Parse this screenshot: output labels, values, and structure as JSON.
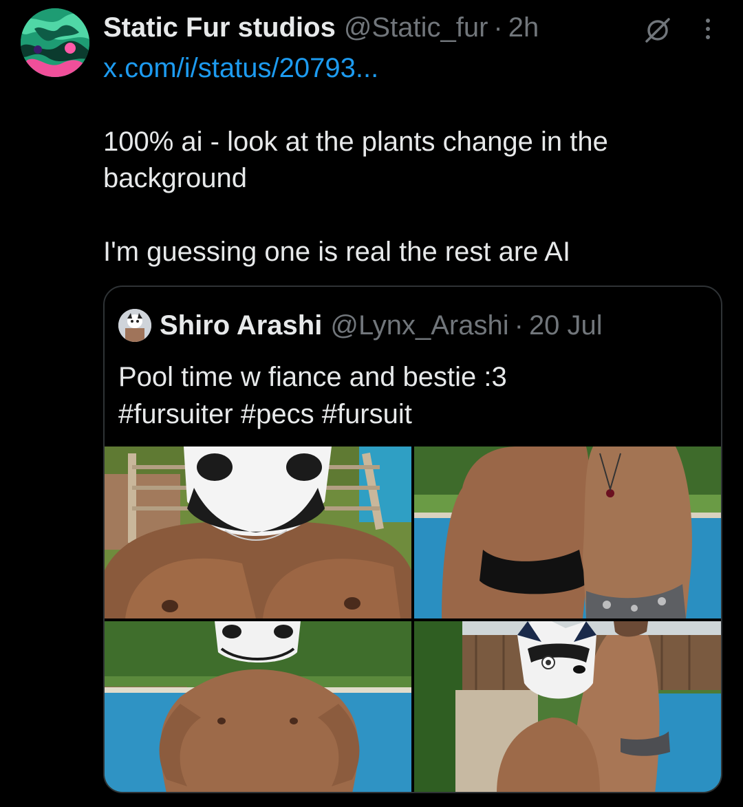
{
  "tweet": {
    "display_name": "Static Fur studios",
    "handle": "@Static_fur",
    "separator": "·",
    "time": "2h",
    "link": "x.com/i/status/20793...",
    "text_line_1": "100% ai - look at the plants change in the background",
    "text_line_2": "I'm guessing one is real the rest are AI",
    "icons": {
      "avatar": "avatar-icon",
      "grok": "grok-icon",
      "more": "more-vertical-icon"
    }
  },
  "quoted": {
    "display_name": "Shiro Arashi",
    "handle": "@Lynx_Arashi",
    "separator": "·",
    "time": "20 Jul",
    "text_line_1": "Pool time w fiance and bestie :3",
    "text_line_2": "#fursuiter #pecs #fursuit"
  },
  "colors": {
    "background": "#000000",
    "text_primary": "#e7e9ea",
    "text_secondary": "#71767b",
    "link": "#1d9bf0",
    "border": "#2f3336"
  }
}
